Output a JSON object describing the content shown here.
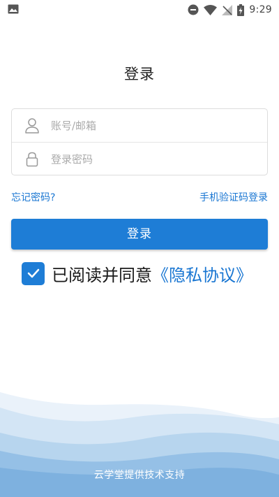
{
  "status_bar": {
    "time": "9:29",
    "icons": [
      "image-icon",
      "do-not-disturb-icon",
      "wifi-icon",
      "no-signal-icon",
      "battery-charging-icon"
    ]
  },
  "page": {
    "title": "登录"
  },
  "form": {
    "account_placeholder": "账号/邮箱",
    "account_value": "",
    "password_placeholder": "登录密码",
    "password_value": ""
  },
  "links": {
    "forgot_password": "忘记密码?",
    "sms_login": "手机验证码登录"
  },
  "login_button": "登录",
  "agreement": {
    "checked": true,
    "text": "已阅读并同意",
    "privacy_link": "《隐私协议》"
  },
  "footer": {
    "text": "云学堂提供技术支持"
  },
  "colors": {
    "accent": "#1e7dd6",
    "link": "#1976d2",
    "wave_light": "#d6e6f5",
    "wave_mid": "#a9cdeb",
    "wave_dark": "#7eb3e0"
  }
}
